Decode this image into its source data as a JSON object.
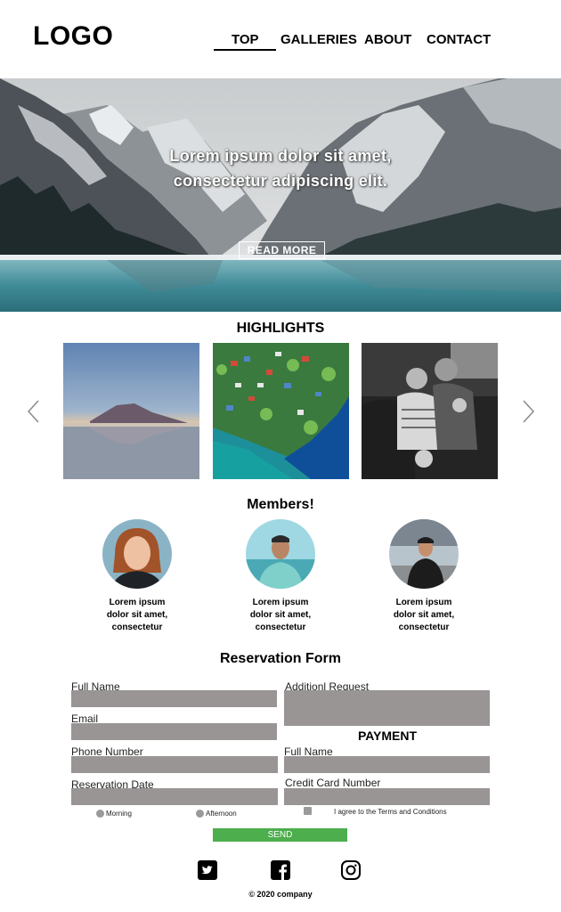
{
  "header": {
    "logo": "LOGO",
    "nav": [
      {
        "label": "TOP",
        "active": true
      },
      {
        "label": "GALLERIES",
        "active": false
      },
      {
        "label": "ABOUT",
        "active": false
      },
      {
        "label": "CONTACT",
        "active": false
      }
    ]
  },
  "hero": {
    "line1": "Lorem ipsum dolor sit amet,",
    "line2": "consectetur adipiscing elit.",
    "button": "READ  MORE"
  },
  "highlights": {
    "title": "HIGHLIGHTS"
  },
  "members": {
    "title": "Members!",
    "items": [
      {
        "line1": "Lorem ipsum",
        "line2": "dolor sit amet,",
        "line3": "consectetur"
      },
      {
        "line1": "Lorem ipsum",
        "line2": "dolor sit amet,",
        "line3": "consectetur"
      },
      {
        "line1": "Lorem ipsum",
        "line2": "dolor sit amet,",
        "line3": "consectetur"
      }
    ]
  },
  "form": {
    "title": "Reservation Form",
    "full_name_label": "Full Name",
    "email_label": "Email",
    "phone_label": "Phone Number",
    "date_label": "Reservation Date",
    "request_label": "Additionl Request",
    "payment_title": "PAYMENT",
    "payment_name_label": "Full Name",
    "card_label": "Credit Card Number",
    "radio_morning": "Morning",
    "radio_afternoon": "Afternoon",
    "terms": "I agree to the Terms and Conditions",
    "send": "SEND"
  },
  "footer": {
    "social": [
      "twitter-icon",
      "facebook-icon",
      "instagram-icon"
    ],
    "copyright": "© 2020 company"
  },
  "colors": {
    "input_bg": "#999595",
    "send_bg": "#4cae4c"
  }
}
